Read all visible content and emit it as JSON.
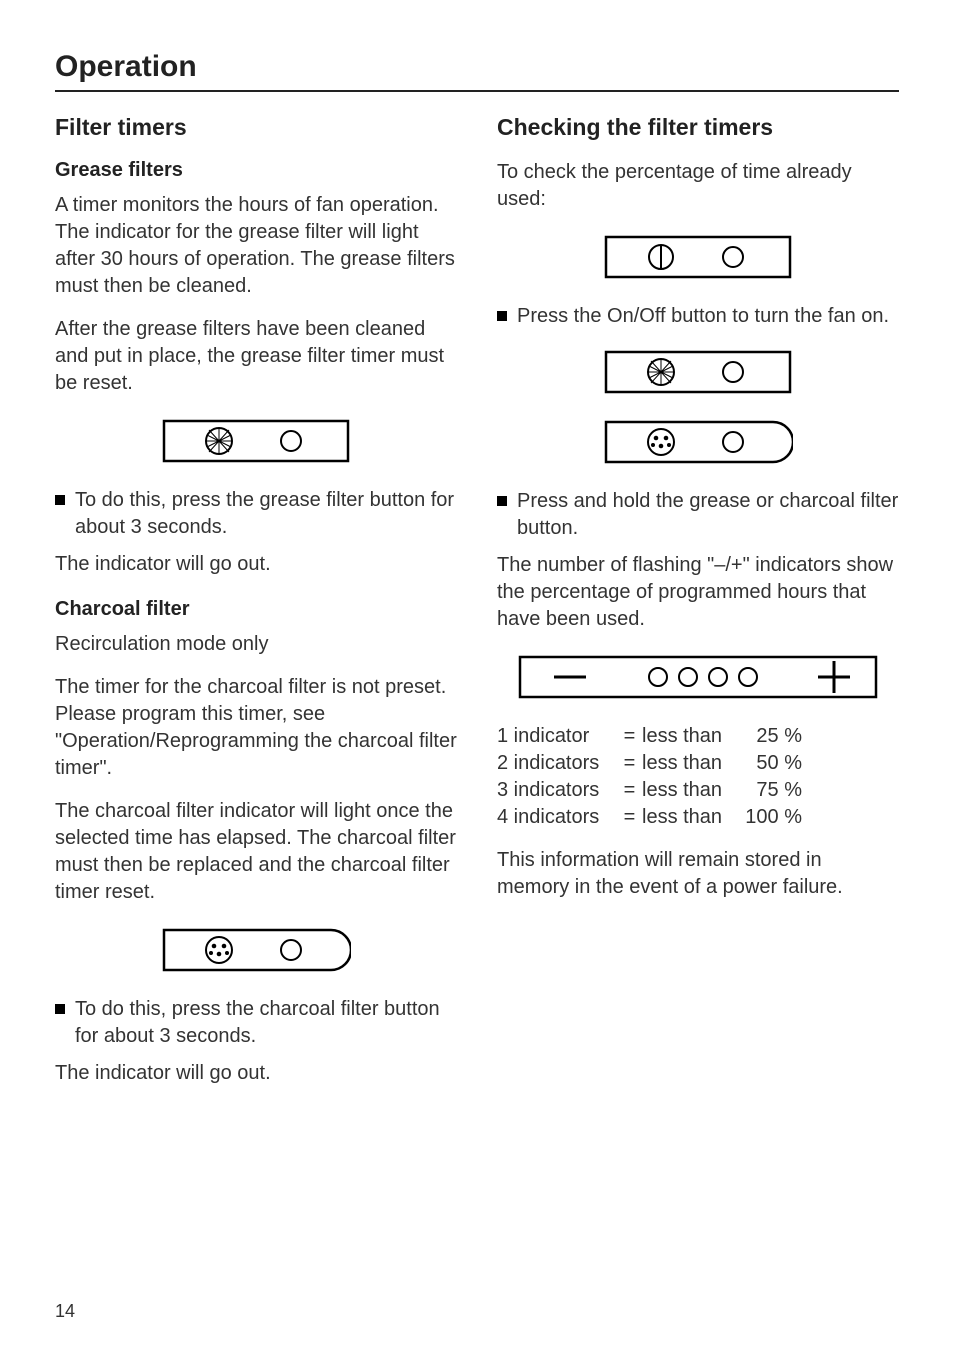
{
  "header": {
    "title": "Operation"
  },
  "left": {
    "h2": "Filter timers",
    "grease": {
      "h3": "Grease filters",
      "p1": "A timer monitors the hours of fan operation. The indicator for the grease filter will light after 30 hours of operation. The grease filters must then be cleaned.",
      "p2": "After the grease filters have been cleaned and put in place, the grease filter timer must be reset.",
      "bullet": "To do this, press the grease filter button for about 3 seconds.",
      "p3": "The indicator will go out."
    },
    "charcoal": {
      "h3": "Charcoal filter",
      "p1": "Recirculation mode only",
      "p2": "The timer for the charcoal filter is not preset. Please program this timer, see \"Operation/Reprogramming the charcoal filter timer\".",
      "p3": "The charcoal filter indicator will light once the selected time has elapsed. The charcoal filter must then be replaced and the charcoal filter timer reset.",
      "bullet": "To do this, press the charcoal filter button for about 3 seconds.",
      "p4": "The indicator will go out."
    }
  },
  "right": {
    "h2": "Checking the filter timers",
    "p1": "To check the percentage of time already used:",
    "bullet1": "Press the On/Off button to turn the fan on.",
    "bullet2": "Press and hold the grease or charcoal filter button.",
    "p2": "The number of flashing \"–/+\" indicators show the percentage of programmed hours that have been used.",
    "table": [
      {
        "c1": "1 indicator",
        "c2": "=",
        "c3": "less than",
        "c4": "25 %"
      },
      {
        "c1": "2 indicators",
        "c2": "=",
        "c3": "less than",
        "c4": "50 %"
      },
      {
        "c1": "3 indicators",
        "c2": "=",
        "c3": "less than",
        "c4": "75 %"
      },
      {
        "c1": "4 indicators",
        "c2": "=",
        "c3": "less than",
        "c4": "100 %"
      }
    ],
    "p3": "This information will remain stored in memory in the event of a power failure."
  },
  "footer": {
    "page_number": "14"
  }
}
